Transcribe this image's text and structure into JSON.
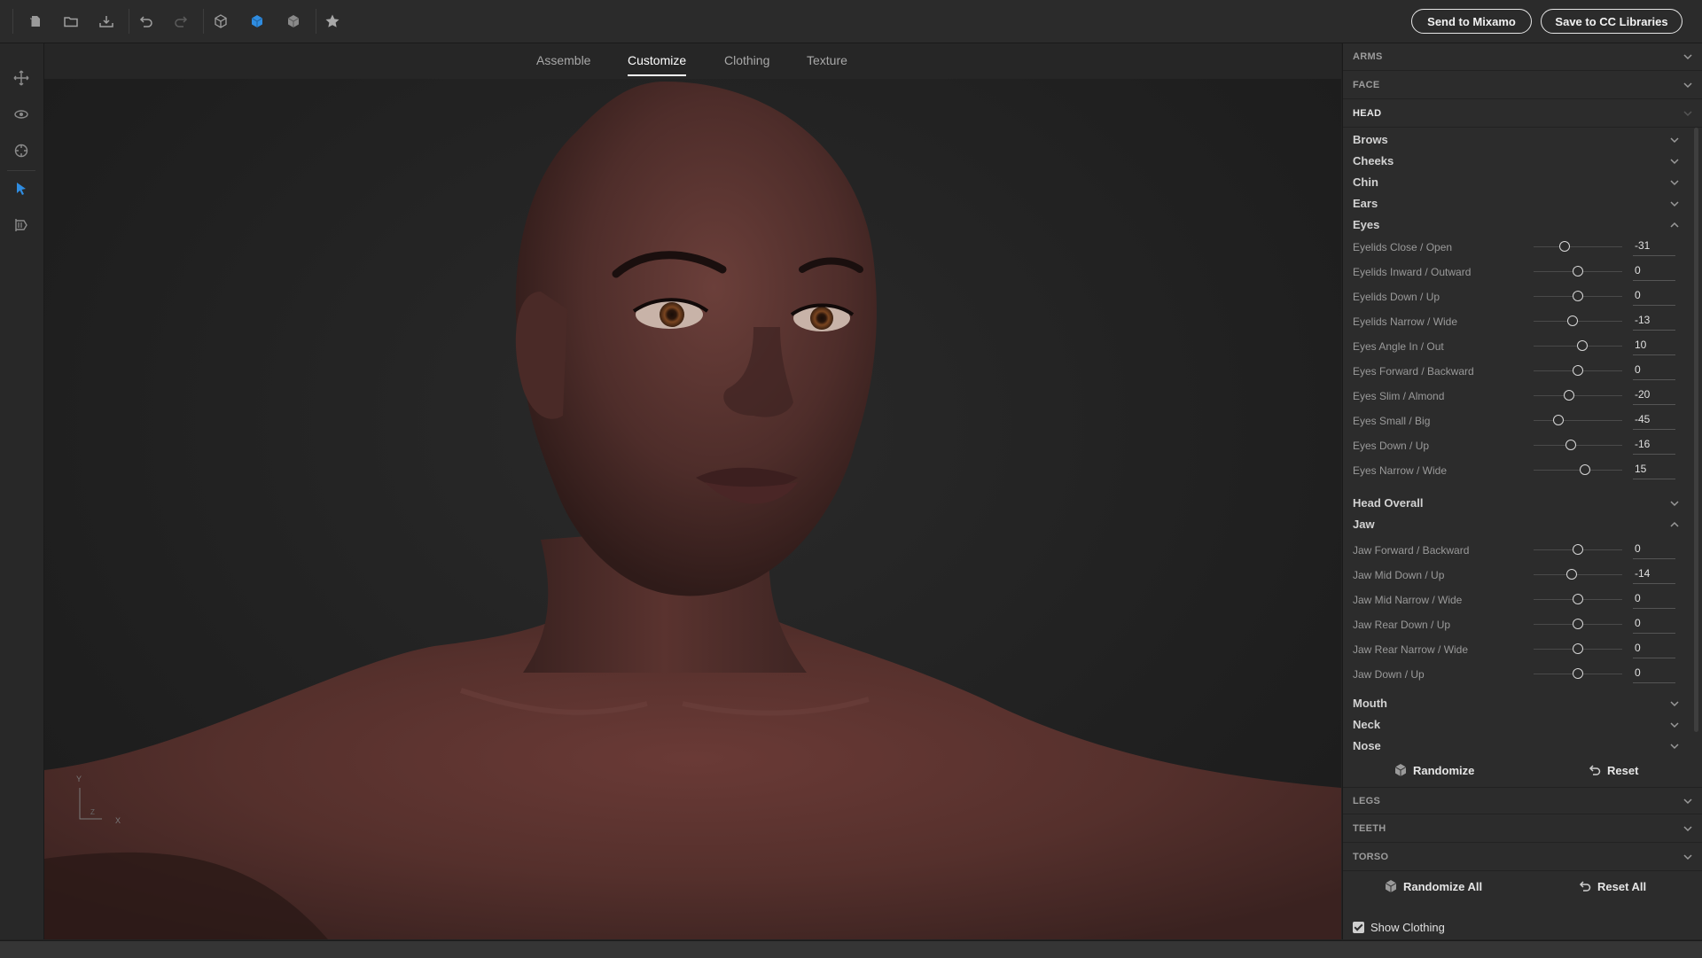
{
  "toolbar": {
    "send_label": "Send to Mixamo",
    "save_label": "Save to CC Libraries",
    "icons": [
      "new-icon",
      "open-folder-icon",
      "export-icon",
      "undo-icon",
      "redo-icon",
      "cube-outline-icon",
      "cube-solid-icon",
      "cube-shaded-icon",
      "star-icon"
    ],
    "accent": "#2f8ce0"
  },
  "left_tools": [
    "move-icon",
    "orbit-icon",
    "target-icon",
    "pointer-icon",
    "film-icon"
  ],
  "tabs": [
    {
      "label": "Assemble",
      "active": false
    },
    {
      "label": "Customize",
      "active": true
    },
    {
      "label": "Clothing",
      "active": false
    },
    {
      "label": "Texture",
      "active": false
    }
  ],
  "viewport": {
    "axis_y": "Y",
    "axis_x": "X",
    "axis_z": "Z"
  },
  "panel": {
    "arms": "ARMS",
    "face": "FACE",
    "head": "HEAD",
    "legs": "LEGS",
    "teeth": "TEETH",
    "torso": "TORSO",
    "groups": {
      "brows": "Brows",
      "cheeks": "Cheeks",
      "chin": "Chin",
      "ears": "Ears",
      "eyes": "Eyes",
      "head_overall": "Head Overall",
      "jaw": "Jaw",
      "mouth": "Mouth",
      "neck": "Neck",
      "nose": "Nose"
    },
    "eyes_sliders": [
      {
        "label": "Eyelids Close / Open",
        "value": "-31"
      },
      {
        "label": "Eyelids Inward / Outward",
        "value": "0"
      },
      {
        "label": "Eyelids Down / Up",
        "value": "0"
      },
      {
        "label": "Eyelids Narrow / Wide",
        "value": "-13"
      },
      {
        "label": "Eyes Angle In / Out",
        "value": "10"
      },
      {
        "label": "Eyes Forward / Backward",
        "value": "0"
      },
      {
        "label": "Eyes Slim / Almond",
        "value": "-20"
      },
      {
        "label": "Eyes Small / Big",
        "value": "-45"
      },
      {
        "label": "Eyes Down / Up",
        "value": "-16"
      },
      {
        "label": "Eyes Narrow / Wide",
        "value": "15"
      }
    ],
    "jaw_sliders": [
      {
        "label": "Jaw Forward / Backward",
        "value": "0"
      },
      {
        "label": "Jaw Mid Down / Up",
        "value": "-14"
      },
      {
        "label": "Jaw Mid Narrow / Wide",
        "value": "0"
      },
      {
        "label": "Jaw Rear Down / Up",
        "value": "0"
      },
      {
        "label": "Jaw Rear Narrow / Wide",
        "value": "0"
      },
      {
        "label": "Jaw Down / Up",
        "value": "0"
      }
    ],
    "randomize": "Randomize",
    "reset": "Reset",
    "randomize_all": "Randomize All",
    "reset_all": "Reset All",
    "show_clothing": "Show Clothing"
  }
}
